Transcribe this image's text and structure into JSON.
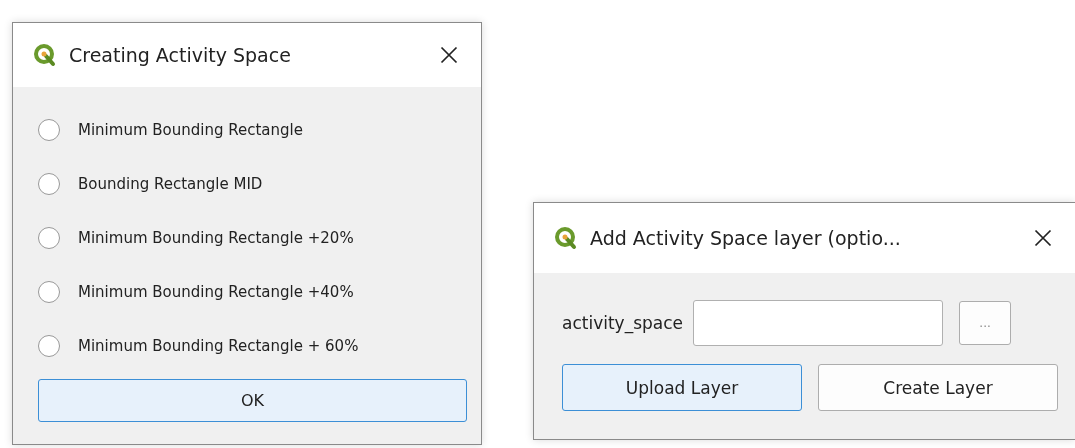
{
  "dialogs": [
    {
      "kind": "options",
      "title": "Creating Activity Space",
      "options": [
        {
          "label": "Minimum Bounding Rectangle",
          "selected": false
        },
        {
          "label": "Bounding Rectangle MID",
          "selected": false
        },
        {
          "label": "Minimum Bounding Rectangle +20%",
          "selected": false
        },
        {
          "label": "Minimum Bounding Rectangle +40%",
          "selected": false
        },
        {
          "label": "Minimum Bounding Rectangle + 60%",
          "selected": false
        }
      ],
      "buttons": [
        {
          "label": "OK",
          "default": true
        }
      ]
    },
    {
      "kind": "layer",
      "title": "Add Activity Space layer (optio...",
      "field_label": "activity_space",
      "browse": "...",
      "buttons": [
        {
          "label": "Upload Layer",
          "default": true
        },
        {
          "label": "Create Layer",
          "default": false
        }
      ]
    }
  ]
}
